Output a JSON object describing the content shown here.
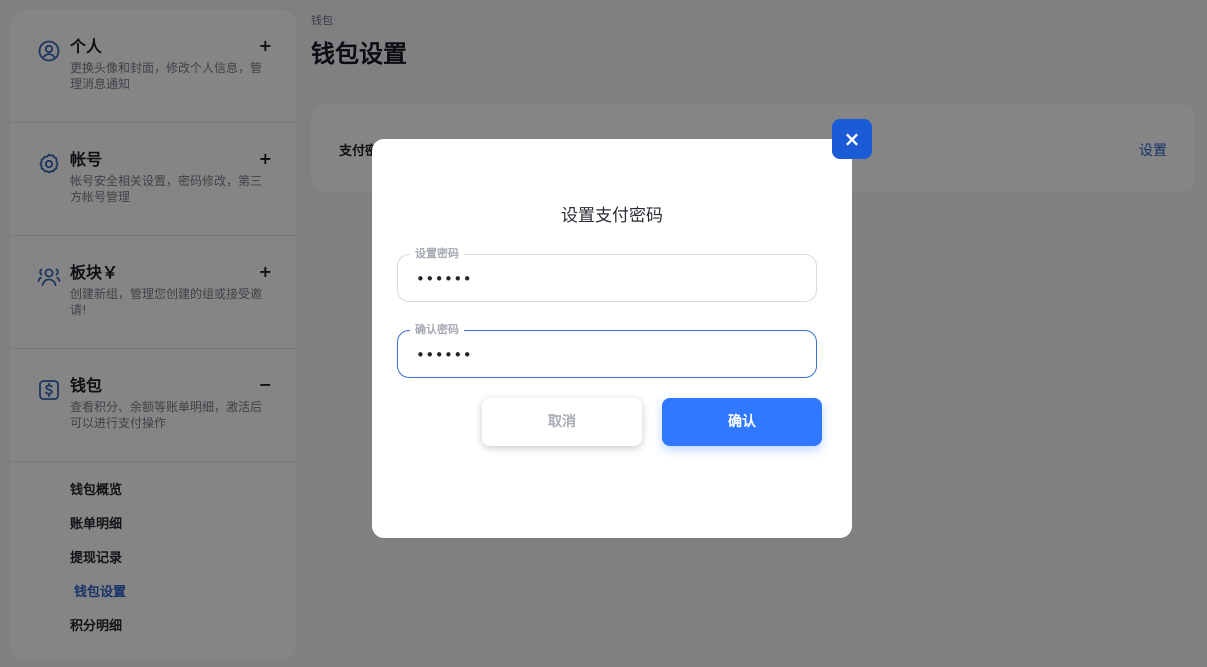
{
  "sidebar": {
    "sections": [
      {
        "title": "个人",
        "desc": "更换头像和封面，修改个人信息，管理消息通知",
        "toggle": "+",
        "icon": "user-circle-icon"
      },
      {
        "title": "帐号",
        "desc": "帐号安全相关设置，密码修改，第三方帐号管理",
        "toggle": "+",
        "icon": "gear-icon"
      },
      {
        "title": "板块￥",
        "desc": "创建新组，管理您创建的组或接受邀请!",
        "toggle": "+",
        "icon": "users-icon"
      },
      {
        "title": "钱包",
        "desc": "查看积分、余额等账单明细，激活后可以进行支付操作",
        "toggle": "−",
        "icon": "dollar-icon"
      }
    ],
    "wallet_items": [
      {
        "label": "钱包概览"
      },
      {
        "label": "账单明细"
      },
      {
        "label": "提现记录"
      },
      {
        "label": "钱包设置",
        "active": true
      },
      {
        "label": "积分明细"
      }
    ]
  },
  "main": {
    "breadcrumb": "钱包",
    "title": "钱包设置",
    "card": {
      "label": "支付密码",
      "action": "设置"
    }
  },
  "modal": {
    "close": "×",
    "title": "设置支付密码",
    "fields": [
      {
        "label": "设置密码",
        "value": "••••••"
      },
      {
        "label": "确认密码",
        "value": "••••••"
      }
    ],
    "cancel_label": "取消",
    "confirm_label": "确认"
  },
  "colors": {
    "accent": "#2f78ff",
    "link": "#2d63c8",
    "close_bg": "#1b5bd6"
  }
}
